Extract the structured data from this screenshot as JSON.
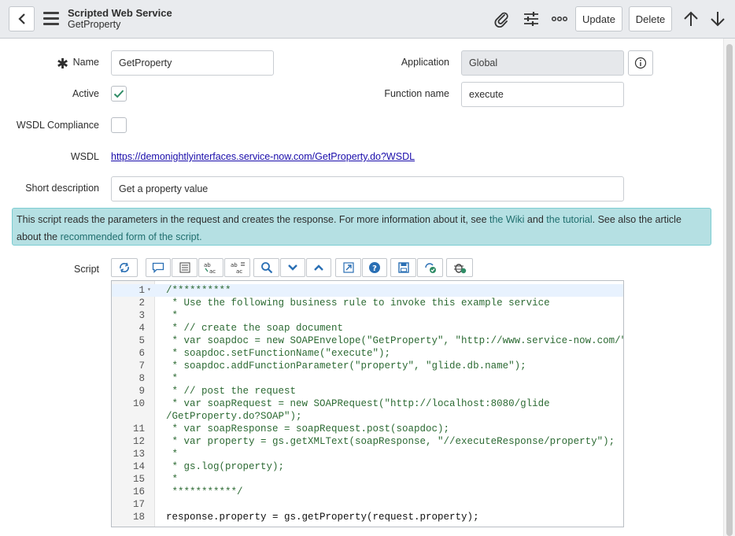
{
  "header": {
    "title": "Scripted Web Service",
    "subtitle": "GetProperty",
    "update_label": "Update",
    "delete_label": "Delete",
    "icons": [
      "back-icon",
      "hamburger-menu-icon",
      "paperclip-icon",
      "sliders-icon",
      "more-options-icon",
      "arrow-up-icon",
      "arrow-down-icon"
    ]
  },
  "form": {
    "required_marker": "✱",
    "name_label": "Name",
    "name_value": "GetProperty",
    "application_label": "Application",
    "application_value": "Global",
    "active_label": "Active",
    "active_checked": true,
    "function_name_label": "Function name",
    "function_name_value": "execute",
    "wsdl_compliance_label": "WSDL Compliance",
    "wsdl_compliance_checked": false,
    "wsdl_label": "WSDL",
    "wsdl_url": "https://demonightlyinterfaces.service-now.com/GetProperty.do?WSDL",
    "short_description_label": "Short description",
    "short_description_value": "Get a property value",
    "script_label": "Script"
  },
  "notice": {
    "text1": "This script reads the parameters in the request and creates the response. For more information about it, see ",
    "link_wiki": "the Wiki",
    "text2": " and ",
    "link_tutorial": "the tutorial",
    "text3": ". See also the article about the ",
    "link_form": "recommended form of the script."
  },
  "toolbar": [
    "toggle-syntax-icon",
    "comment-icon",
    "format-code-icon",
    "replace-icon",
    "replace-all-icon",
    "search-icon",
    "collapse-icon",
    "expand-icon",
    "fullscreen-icon",
    "help-icon",
    "save-icon",
    "syntax-check-icon",
    "debug-icon"
  ],
  "editor": {
    "lines": [
      {
        "n": "1",
        "fold": "▾",
        "text": "/**********",
        "style": "comment",
        "active": true
      },
      {
        "n": "2",
        "text": " * Use the following business rule to invoke this example service",
        "style": "comment"
      },
      {
        "n": "3",
        "text": " *",
        "style": "comment"
      },
      {
        "n": "4",
        "text": " * // create the soap document",
        "style": "comment"
      },
      {
        "n": "5",
        "text": " * var soapdoc = new SOAPEnvelope(\"GetProperty\", \"http://www.service-now.com/\");",
        "style": "comment"
      },
      {
        "n": "6",
        "text": " * soapdoc.setFunctionName(\"execute\");",
        "style": "comment"
      },
      {
        "n": "7",
        "text": " * soapdoc.addFunctionParameter(\"property\", \"glide.db.name\");",
        "style": "comment"
      },
      {
        "n": "8",
        "text": " *",
        "style": "comment"
      },
      {
        "n": "9",
        "text": " * // post the request",
        "style": "comment"
      },
      {
        "n": "10",
        "text": " * var soapRequest = new SOAPRequest(\"http://localhost:8080/glide",
        "style": "comment"
      },
      {
        "n": "",
        "text": "/GetProperty.do?SOAP\");",
        "style": "comment"
      },
      {
        "n": "11",
        "text": " * var soapResponse = soapRequest.post(soapdoc);",
        "style": "comment"
      },
      {
        "n": "12",
        "text": " * var property = gs.getXMLText(soapResponse, \"//executeResponse/property\");",
        "style": "comment"
      },
      {
        "n": "13",
        "text": " *",
        "style": "comment"
      },
      {
        "n": "14",
        "text": " * gs.log(property);",
        "style": "comment"
      },
      {
        "n": "15",
        "text": " *",
        "style": "comment"
      },
      {
        "n": "16",
        "text": " ***********/",
        "style": "comment"
      },
      {
        "n": "17",
        "text": "",
        "style": "plain"
      },
      {
        "n": "18",
        "text": "response.property = gs.getProperty(request.property);",
        "style": "plain"
      }
    ]
  }
}
